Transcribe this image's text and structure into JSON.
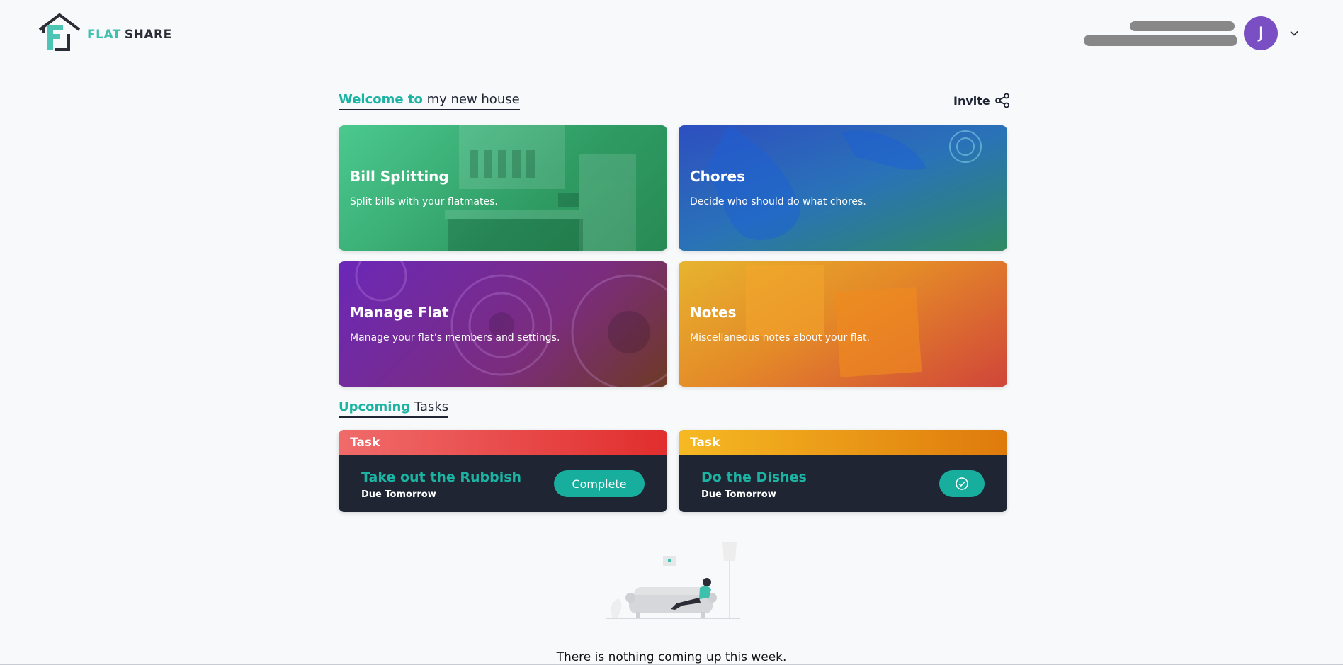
{
  "header": {
    "logo_word1": "FLAT",
    "logo_word2": "SHARE",
    "avatar_initial": "J"
  },
  "welcome": {
    "accent": "Welcome to",
    "rest": "my new house"
  },
  "invite_label": "Invite",
  "cards": [
    {
      "title": "Bill Splitting",
      "desc": "Split bills with your flatmates."
    },
    {
      "title": "Chores",
      "desc": "Decide who should do what chores."
    },
    {
      "title": "Manage Flat",
      "desc": "Manage your flat's members and settings."
    },
    {
      "title": "Notes",
      "desc": "Miscellaneous notes about your flat."
    }
  ],
  "upcoming": {
    "accent": "Upcoming",
    "rest": "Tasks"
  },
  "tasks": [
    {
      "header": "Task",
      "title": "Take out the Rubbish",
      "due": "Due Tomorrow",
      "action_label": "Complete"
    },
    {
      "header": "Task",
      "title": "Do the Dishes",
      "due": "Due Tomorrow",
      "action_icon": "check-circle-icon"
    }
  ],
  "empty_message": "There is nothing coming up this week.",
  "colors": {
    "accent_teal": "#1cb3a3",
    "task_dark": "#1f2533",
    "avatar_purple": "#7a4fc4"
  }
}
